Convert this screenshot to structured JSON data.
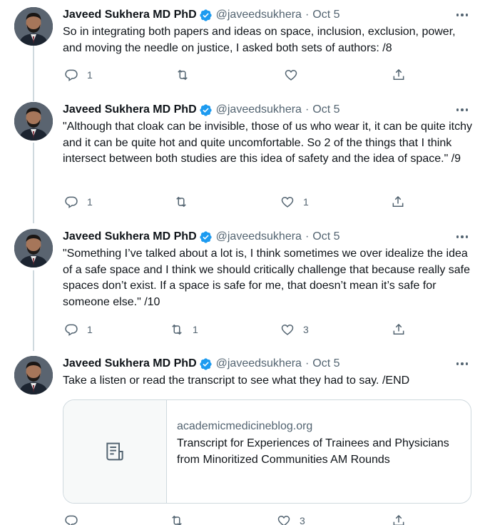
{
  "author": {
    "name": "Javeed Sukhera MD PhD",
    "handle": "@javeedsukhera",
    "separator": "·",
    "verified_icon": "verified-badge-icon"
  },
  "colors": {
    "verified": "#1d9bf0",
    "secondary_text": "#536471",
    "border": "#cfd9de"
  },
  "tweets": [
    {
      "date": "Oct 5",
      "text": "So in integrating both papers and ideas on space, inclusion, exclusion, power, and moving the needle on justice, I asked both sets of authors: /8",
      "reply_count": "1",
      "retweet_count": "",
      "like_count": ""
    },
    {
      "date": "Oct 5",
      "text": "\"Although that cloak can be invisible, those of us who wear it, it can be quite itchy and it can be quite hot and quite uncomfortable. So 2 of the things that I think intersect between both studies are this idea of safety and the idea of space.\" /9",
      "reply_count": "1",
      "retweet_count": "",
      "like_count": "1"
    },
    {
      "date": "Oct 5",
      "text": "\"Something I’ve talked about a lot is, I think sometimes we over idealize the idea of a safe space and I think we should critically challenge that because really safe spaces don’t exist. If a space is safe for me, that doesn’t mean it’s safe for someone else.\" /10",
      "reply_count": "1",
      "retweet_count": "1",
      "like_count": "3"
    },
    {
      "date": "Oct 5",
      "text": "Take a listen or read the transcript to see what they had to say. /END",
      "reply_count": "",
      "retweet_count": "",
      "like_count": "3",
      "card": {
        "domain": "academicmedicineblog.org",
        "title": "Transcript for Experiences of Trainees and Physicians from Minoritized Communities AM Rounds",
        "icon": "article-icon"
      }
    }
  ]
}
